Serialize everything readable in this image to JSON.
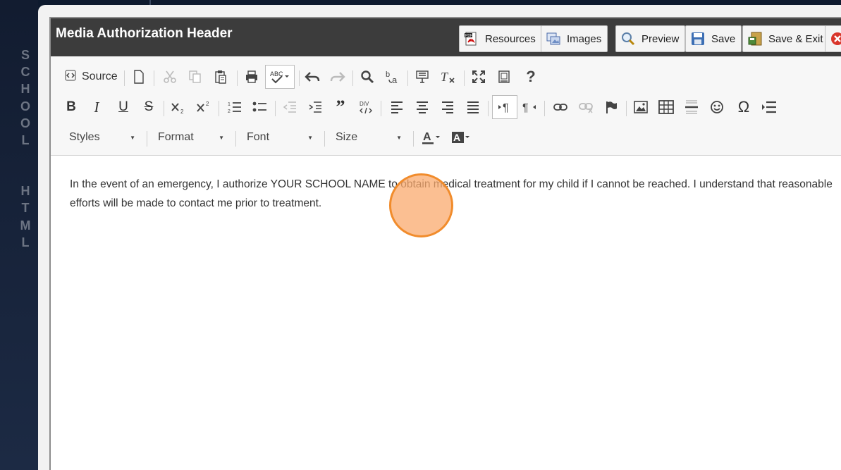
{
  "sidebar_letters": [
    "S",
    "C",
    "H",
    "O",
    "O",
    "L",
    "",
    "H",
    "T",
    "M",
    "L"
  ],
  "editor": {
    "title": "Media Authorization Header"
  },
  "header_buttons": [
    {
      "label": "Resources",
      "icon": "pdf-icon"
    },
    {
      "label": "Images",
      "icon": "images-icon"
    },
    {
      "label": "Preview",
      "icon": "magnifier-icon"
    },
    {
      "label": "Save",
      "icon": "floppy-icon"
    },
    {
      "label": "Save & Exit",
      "icon": "save-exit-icon"
    },
    {
      "label": "",
      "icon": "close-icon"
    }
  ],
  "toolbar": {
    "source_label": "Source",
    "combos": {
      "styles": "Styles",
      "format": "Format",
      "font": "Font",
      "size": "Size"
    }
  },
  "content": {
    "text": "In the event of an emergency, I authorize YOUR SCHOOL NAME to obtain medical treatment for my child if I cannot be reached. I understand that reasonable efforts will be made to contact me prior to treatment."
  },
  "colors": {
    "header_bg": "#3c3c3c",
    "click_indicator": "#f18c2c"
  }
}
